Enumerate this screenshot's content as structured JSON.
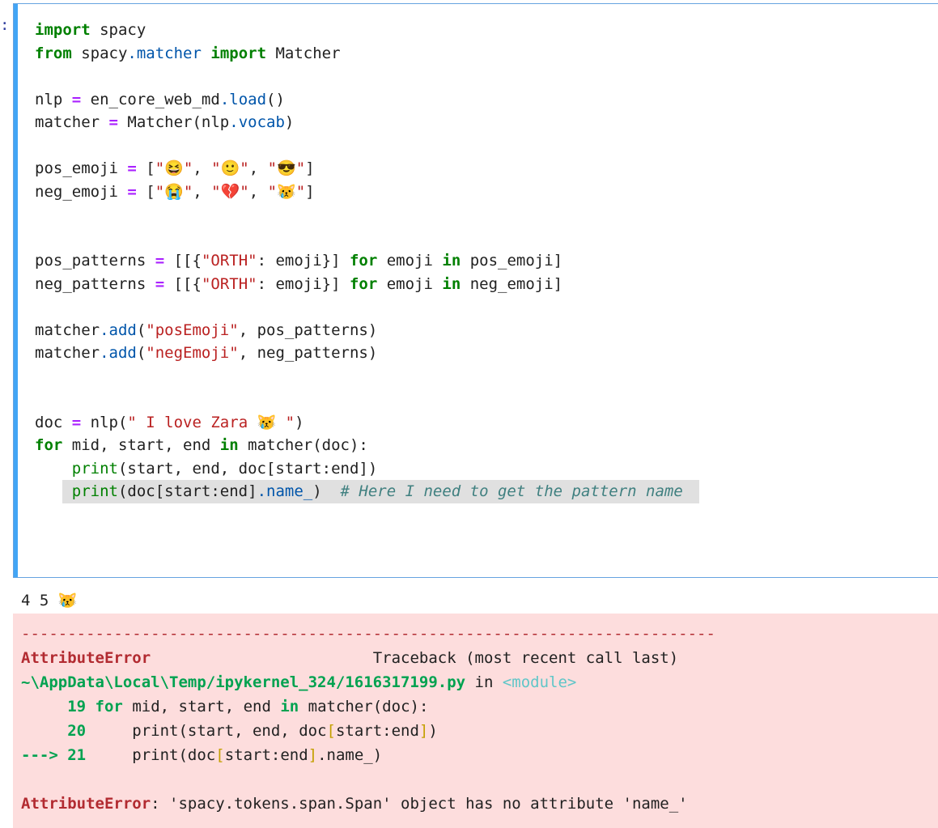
{
  "prompt": ":",
  "code_lines": [
    [
      {
        "t": "import",
        "c": "kw"
      },
      {
        "t": " spacy"
      }
    ],
    [
      {
        "t": "from",
        "c": "kw"
      },
      {
        "t": " spacy"
      },
      {
        "t": ".matcher",
        "c": "attr"
      },
      {
        "t": " "
      },
      {
        "t": "import",
        "c": "kw"
      },
      {
        "t": " Matcher"
      }
    ],
    [],
    [
      {
        "t": "nlp "
      },
      {
        "t": "=",
        "c": "op"
      },
      {
        "t": " en_core_web_md"
      },
      {
        "t": ".load",
        "c": "attr"
      },
      {
        "t": "()"
      }
    ],
    [
      {
        "t": "matcher "
      },
      {
        "t": "=",
        "c": "op"
      },
      {
        "t": " Matcher(nlp"
      },
      {
        "t": ".vocab",
        "c": "attr"
      },
      {
        "t": ")"
      }
    ],
    [],
    [
      {
        "t": "pos_emoji "
      },
      {
        "t": "=",
        "c": "op"
      },
      {
        "t": " ["
      },
      {
        "t": "\"😆\"",
        "c": "str"
      },
      {
        "t": ", "
      },
      {
        "t": "\"🙂\"",
        "c": "str"
      },
      {
        "t": ", "
      },
      {
        "t": "\"😎\"",
        "c": "str"
      },
      {
        "t": "]"
      }
    ],
    [
      {
        "t": "neg_emoji "
      },
      {
        "t": "=",
        "c": "op"
      },
      {
        "t": " ["
      },
      {
        "t": "\"😭\"",
        "c": "str"
      },
      {
        "t": ", "
      },
      {
        "t": "\"💔\"",
        "c": "str"
      },
      {
        "t": ", "
      },
      {
        "t": "\"😿\"",
        "c": "str"
      },
      {
        "t": "]"
      }
    ],
    [],
    [],
    [
      {
        "t": "pos_patterns "
      },
      {
        "t": "=",
        "c": "op"
      },
      {
        "t": " [[{"
      },
      {
        "t": "\"ORTH\"",
        "c": "str"
      },
      {
        "t": ": emoji}] "
      },
      {
        "t": "for",
        "c": "kw"
      },
      {
        "t": " emoji "
      },
      {
        "t": "in",
        "c": "kw"
      },
      {
        "t": " pos_emoji]"
      }
    ],
    [
      {
        "t": "neg_patterns "
      },
      {
        "t": "=",
        "c": "op"
      },
      {
        "t": " [[{"
      },
      {
        "t": "\"ORTH\"",
        "c": "str"
      },
      {
        "t": ": emoji}] "
      },
      {
        "t": "for",
        "c": "kw"
      },
      {
        "t": " emoji "
      },
      {
        "t": "in",
        "c": "kw"
      },
      {
        "t": " neg_emoji]"
      }
    ],
    [],
    [
      {
        "t": "matcher"
      },
      {
        "t": ".add",
        "c": "attr"
      },
      {
        "t": "("
      },
      {
        "t": "\"posEmoji\"",
        "c": "str"
      },
      {
        "t": ", pos_patterns)"
      }
    ],
    [
      {
        "t": "matcher"
      },
      {
        "t": ".add",
        "c": "attr"
      },
      {
        "t": "("
      },
      {
        "t": "\"negEmoji\"",
        "c": "str"
      },
      {
        "t": ", neg_patterns)"
      }
    ],
    [],
    [],
    [
      {
        "t": "doc "
      },
      {
        "t": "=",
        "c": "op"
      },
      {
        "t": " nlp("
      },
      {
        "t": "\" I love Zara 😿 \"",
        "c": "str"
      },
      {
        "t": ")"
      }
    ],
    [
      {
        "t": "for",
        "c": "kw"
      },
      {
        "t": " mid, start, end "
      },
      {
        "t": "in",
        "c": "kw"
      },
      {
        "t": " matcher(doc):"
      }
    ],
    [
      {
        "t": "    "
      },
      {
        "t": "print",
        "c": "fn"
      },
      {
        "t": "(start, end, doc[start:end])"
      }
    ],
    [
      {
        "t": "    "
      },
      {
        "t": "print",
        "c": "fn",
        "hl_start": true
      },
      {
        "t": "(doc[start:end]"
      },
      {
        "t": ".name_",
        "c": "attr"
      },
      {
        "t": ")  "
      },
      {
        "t": "# Here I need to get the pattern name",
        "c": "cm",
        "hl_end": true
      }
    ]
  ],
  "stdout": "4 5 😿",
  "traceback": {
    "dashes": "---------------------------------------------------------------------------",
    "error_name": "AttributeError",
    "traceback_header": "Traceback (most recent call last)",
    "file_path": "~\\AppData\\Local\\Temp/ipykernel_324/1616317199.py",
    "in_word": " in ",
    "module": "<module>",
    "lines": [
      {
        "arrow": "     ",
        "num": "19",
        "code": [
          {
            "t": " "
          },
          {
            "t": "for",
            "c": "tb-green"
          },
          {
            "t": " mid, start, end "
          },
          {
            "t": "in",
            "c": "tb-green"
          },
          {
            "t": " matcher(doc):"
          }
        ]
      },
      {
        "arrow": "     ",
        "num": "20",
        "code": [
          {
            "t": "     print(start, end, doc"
          },
          {
            "t": "[",
            "c": "tb-paren"
          },
          {
            "t": "start:end"
          },
          {
            "t": "]",
            "c": "tb-paren"
          },
          {
            "t": ")"
          }
        ]
      },
      {
        "arrow": "---> ",
        "num": "21",
        "code": [
          {
            "t": "     print(doc"
          },
          {
            "t": "[",
            "c": "tb-paren"
          },
          {
            "t": "start:end"
          },
          {
            "t": "]",
            "c": "tb-paren"
          },
          {
            "t": ".name_)"
          }
        ]
      }
    ],
    "final_error_name": "AttributeError",
    "final_message": ": 'spacy.tokens.span.Span' object has no attribute 'name_'"
  }
}
